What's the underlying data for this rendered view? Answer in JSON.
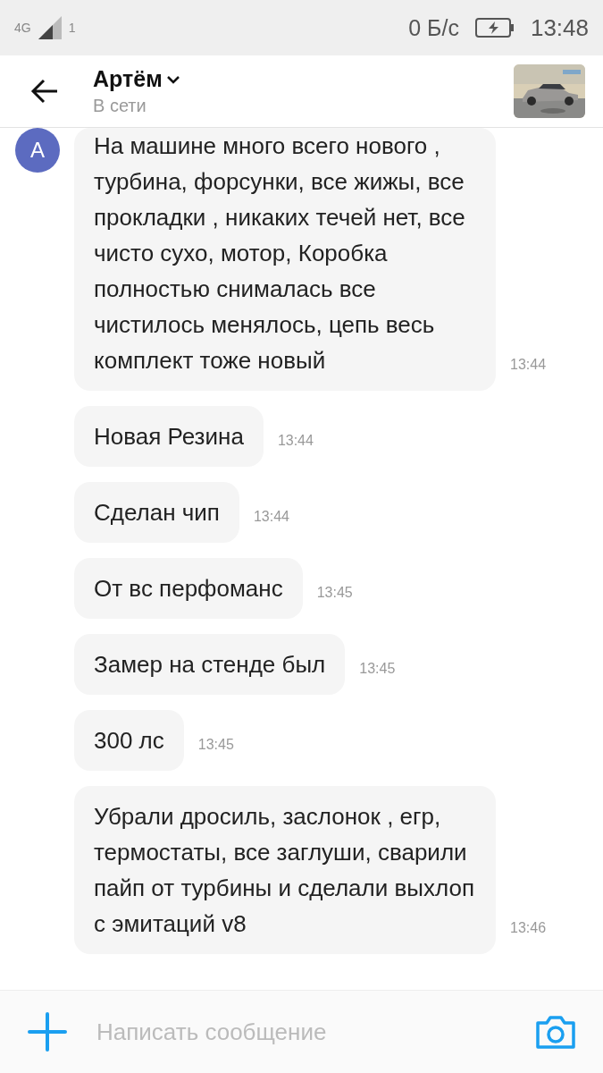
{
  "status_bar": {
    "network": "4G",
    "sim": "1",
    "speed": "0 Б/с",
    "time": "13:48"
  },
  "header": {
    "name": "Артём",
    "status": "В сети"
  },
  "messages": [
    {
      "avatar": "A",
      "text": "На машине много всего нового , турбина, форсунки, все жижы, все прокладки , никаких течей нет, все чисто сухо, мотор, Коробка полностью снималась все чистилось менялось, цепь весь комплект  тоже новый",
      "time": "13:44"
    },
    {
      "text": "Новая Резина",
      "time": "13:44"
    },
    {
      "text": "Сделан чип",
      "time": "13:44"
    },
    {
      "text": "От вс перфоманс",
      "time": "13:45"
    },
    {
      "text": "Замер на стенде был",
      "time": "13:45"
    },
    {
      "text": "300 лс",
      "time": "13:45"
    },
    {
      "text": "Убрали дросиль, заслонок , егр, термостаты, все заглуши, сварили пайп от турбины и сделали выхлоп с эмитаций v8",
      "time": "13:46"
    }
  ],
  "composer": {
    "placeholder": "Написать сообщение"
  }
}
